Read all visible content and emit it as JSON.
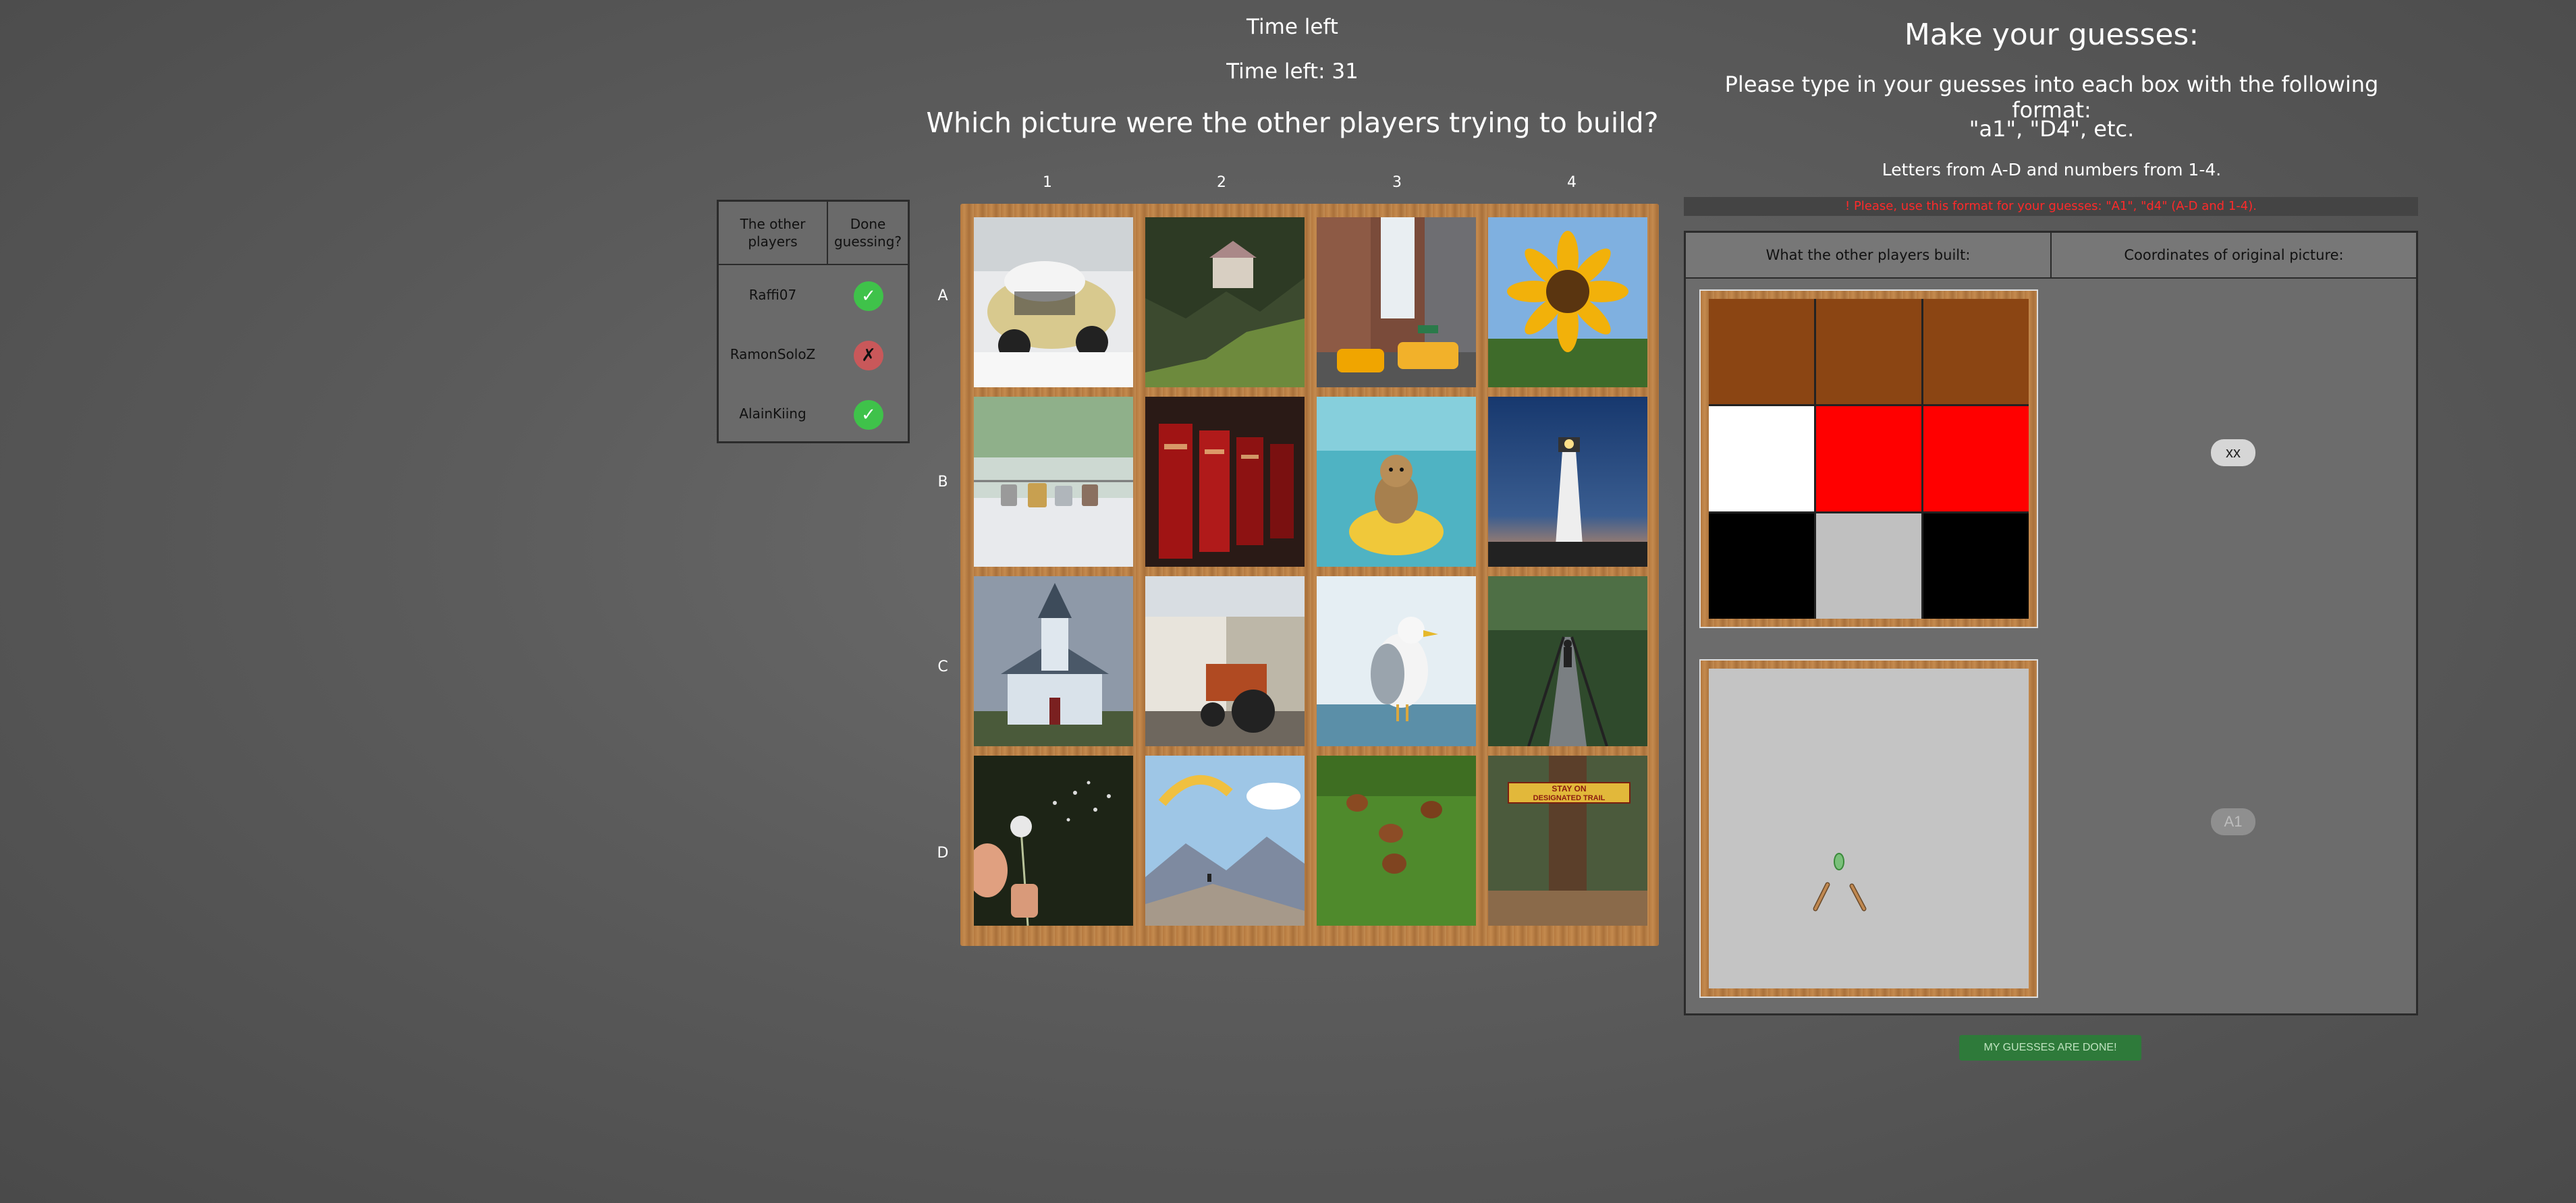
{
  "header": {
    "time_title": "Time left",
    "time_left": "Time left: 31",
    "question": "Which picture were the other players trying to build?"
  },
  "players": {
    "col_players": "The other players",
    "col_done": "Done guessing?",
    "rows": [
      {
        "name": "Raffi07",
        "done": true,
        "mark": "✓"
      },
      {
        "name": "RamonSoloZ",
        "done": false,
        "mark": "✗"
      },
      {
        "name": "AlainKiing",
        "done": true,
        "mark": "✓"
      }
    ]
  },
  "grid": {
    "columns": [
      "1",
      "2",
      "3",
      "4"
    ],
    "rows": [
      "A",
      "B",
      "C",
      "D"
    ],
    "tiles": [
      {
        "id": "A1",
        "icon": "snowy-beetle-car-image"
      },
      {
        "id": "A2",
        "icon": "cliff-castle-forest-image"
      },
      {
        "id": "A3",
        "icon": "city-street-taxis-image"
      },
      {
        "id": "A4",
        "icon": "sunflower-image"
      },
      {
        "id": "B1",
        "icon": "love-padlocks-image"
      },
      {
        "id": "B2",
        "icon": "red-phone-booths-image"
      },
      {
        "id": "B3",
        "icon": "dog-on-paddleboard-image"
      },
      {
        "id": "B4",
        "icon": "lighthouse-night-image"
      },
      {
        "id": "C1",
        "icon": "church-image"
      },
      {
        "id": "C2",
        "icon": "old-tractor-image"
      },
      {
        "id": "C3",
        "icon": "seagull-image"
      },
      {
        "id": "C4",
        "icon": "forest-bridge-image"
      },
      {
        "id": "D1",
        "icon": "dandelion-blow-image"
      },
      {
        "id": "D2",
        "icon": "paraglider-mountains-image"
      },
      {
        "id": "D3",
        "icon": "chickens-grass-image"
      },
      {
        "id": "D4",
        "icon": "stay-on-trail-sign-image"
      }
    ],
    "sign_text_1": "STAY ON",
    "sign_text_2": "DESIGNATED TRAIL"
  },
  "guess": {
    "title": "Make your guesses:",
    "instruction": "Please type in your guesses into each box with the following format:",
    "format": "\"a1\", \"D4\", etc.",
    "range": "Letters from A-D and numbers from 1-4.",
    "error": "! Please, use this format for your guesses: \"A1\", \"d4\" (A-D and 1-4).",
    "col_built": "What the other players built:",
    "col_coords": "Coordinates of original picture:",
    "builds": [
      {
        "type": "pixel-grid",
        "cells": [
          "#8b4513",
          "#8b4513",
          "#8b4513",
          "#ffffff",
          "#ff0000",
          "#ff0000",
          "#000000",
          "#c0c0c0",
          "#000000"
        ],
        "input_value": "xx"
      },
      {
        "type": "drawing",
        "input_value": "",
        "input_placeholder": "A1"
      }
    ],
    "done_button": "MY GUESSES ARE DONE!"
  },
  "colors": {
    "ok": "#3fc24a",
    "not_done": "#c9585a",
    "error": "#ff2a2a",
    "done_button": "#2e7a3a"
  }
}
